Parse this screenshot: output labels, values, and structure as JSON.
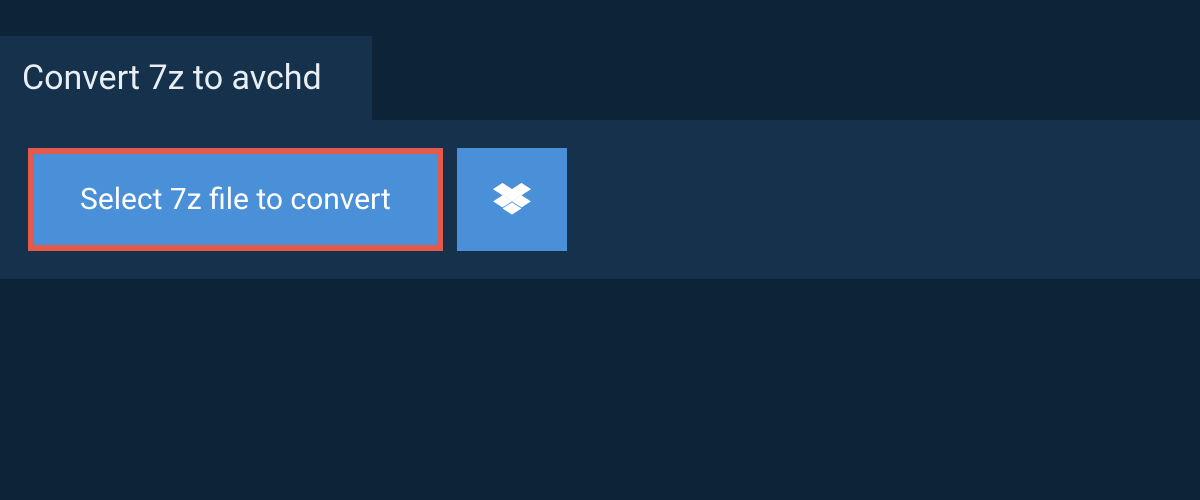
{
  "header": {
    "title": "Convert 7z to avchd"
  },
  "actions": {
    "select_file_label": "Select 7z file to convert"
  },
  "colors": {
    "background_dark": "#0d2438",
    "panel": "#15314b",
    "button_blue": "#4a90d9",
    "highlight_border": "#e35a4a",
    "text_light": "#e8eef4",
    "text_white": "#ffffff"
  }
}
